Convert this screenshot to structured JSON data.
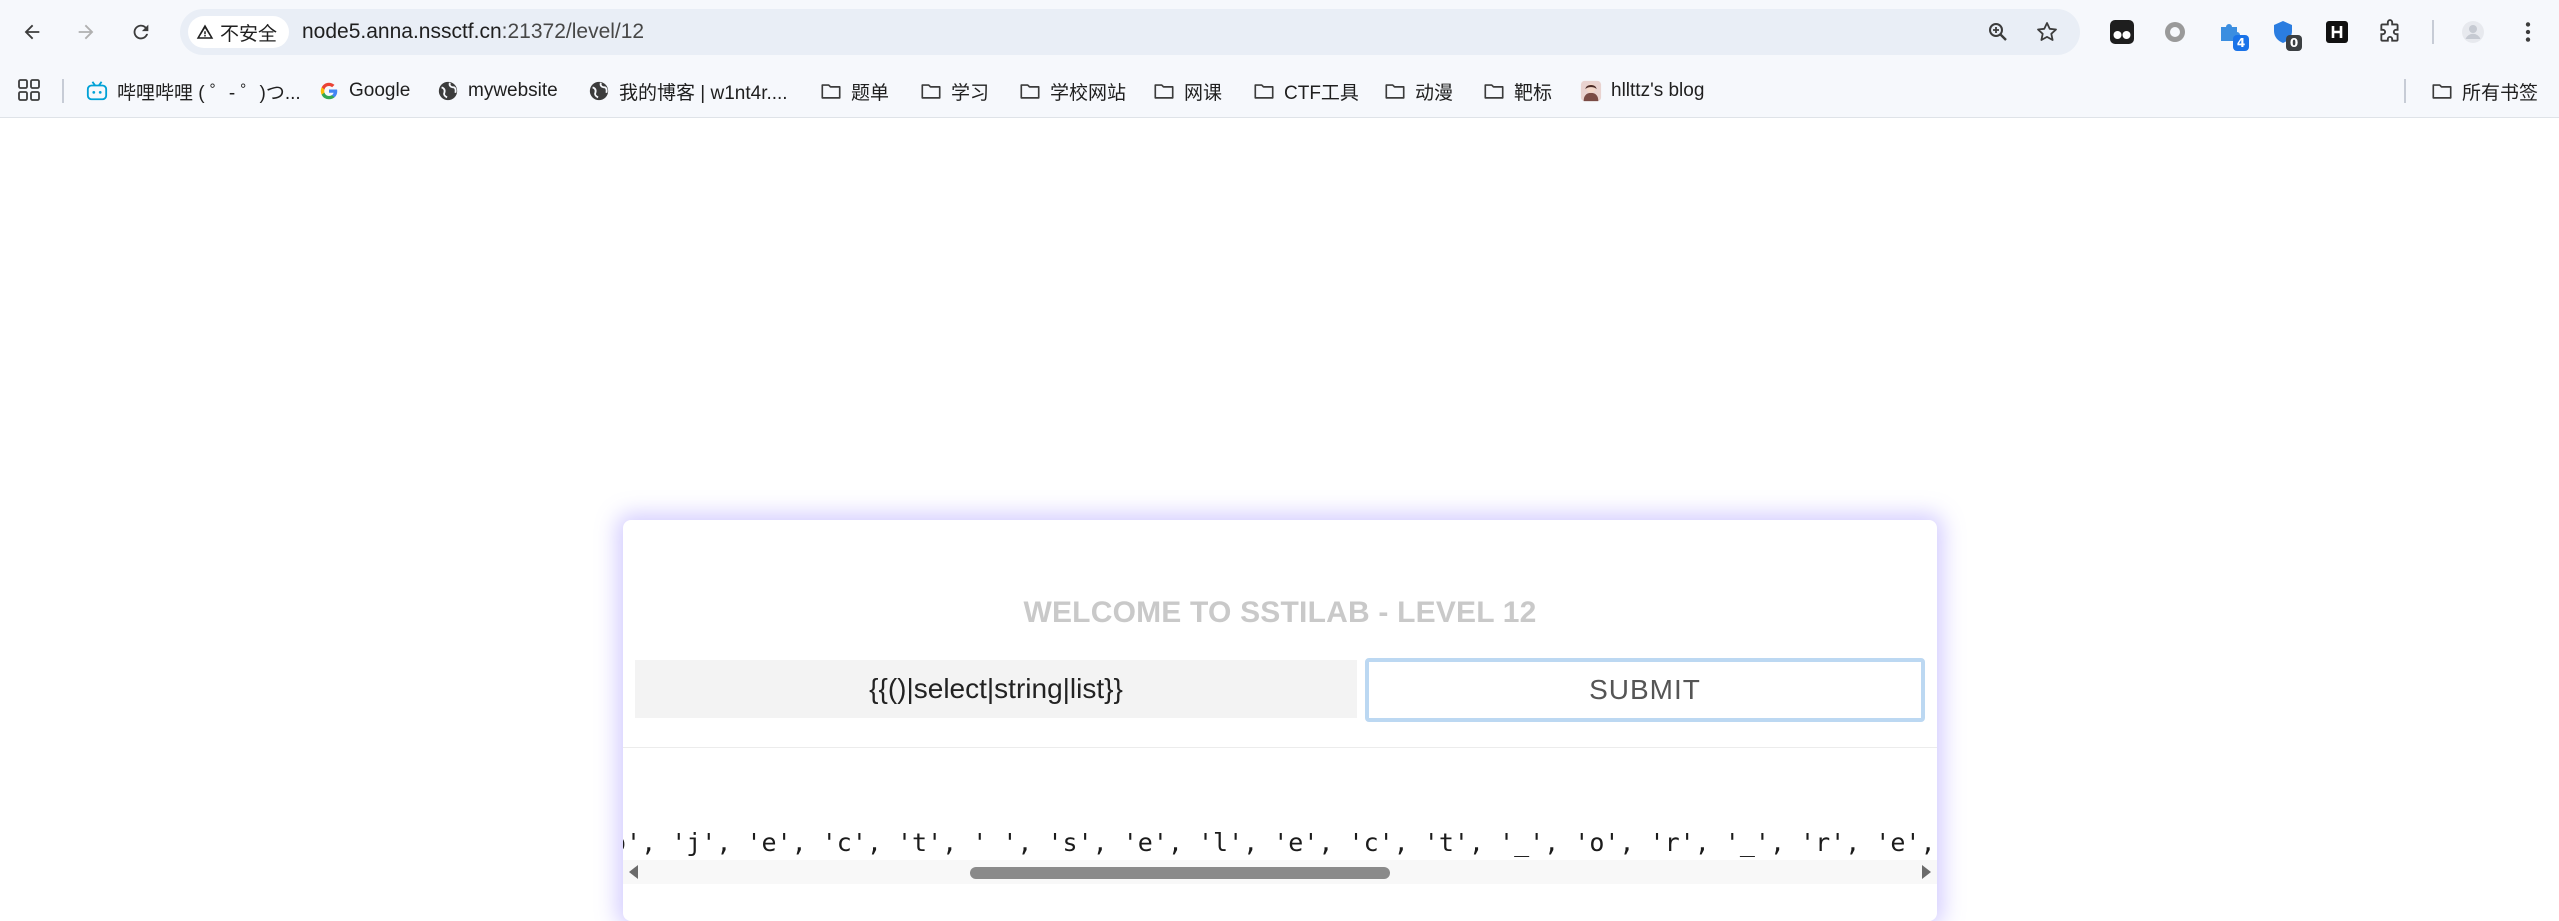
{
  "browser": {
    "security_label": "不安全",
    "url_host": "node5.anna.nssctf.cn",
    "url_rest": ":21372/level/12",
    "extensions": [
      {
        "name": "tampermonkey-icon",
        "badge": ""
      },
      {
        "name": "record-icon",
        "badge": ""
      },
      {
        "name": "puzzle-ext-icon",
        "badge": "4"
      },
      {
        "name": "shield-ext-icon",
        "badge": "0"
      },
      {
        "name": "hackbar-icon",
        "badge": ""
      }
    ]
  },
  "bookmarks": {
    "items": [
      {
        "label": "哔哩哔哩 ( ゜- ゜)つ...",
        "icon": "bilibili-icon"
      },
      {
        "label": "Google",
        "icon": "google-icon"
      },
      {
        "label": "mywebsite",
        "icon": "globe-icon"
      },
      {
        "label": "我的博客 | w1nt4r....",
        "icon": "globe-icon"
      },
      {
        "label": "题单",
        "icon": "folder-icon"
      },
      {
        "label": "学习",
        "icon": "folder-icon"
      },
      {
        "label": "学校网站",
        "icon": "folder-icon"
      },
      {
        "label": "网课",
        "icon": "folder-icon"
      },
      {
        "label": "CTF工具",
        "icon": "folder-icon"
      },
      {
        "label": "动漫",
        "icon": "folder-icon"
      },
      {
        "label": "靶标",
        "icon": "folder-icon"
      },
      {
        "label": "hllttz's blog",
        "icon": "avatar-icon"
      }
    ],
    "all_bookmarks": "所有书签"
  },
  "page": {
    "title": "WELCOME TO SSTILAB - LEVEL 12",
    "payload_value": "{{()|select|string|list}}",
    "submit_label": "SUBMIT",
    "result_text": "o', 'j', 'e', 'c', 't', ' ', 's', 'e', 'l', 'e', 'c', 't', '_', 'o', 'r', '_', 'r', 'e', 'j', 'e', 'c', 't'"
  },
  "colors": {
    "card_glow": "#826eff",
    "title": "#c9c9c9",
    "submit_border": "#bcd8f2"
  }
}
